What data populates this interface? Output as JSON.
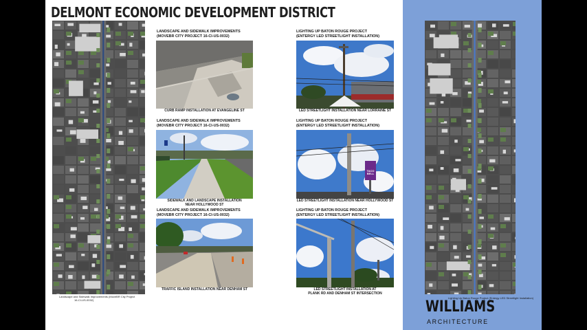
{
  "title": "DELMONT ECONOMIC DEVELOPMENT DISTRICT",
  "left_map_caption": {
    "line1": "Landscape and Sidewalk Improvements (MoveBR City Project",
    "line2": "16-CI-US-0032)"
  },
  "right_map_caption": "Lighting Up Baton Rouge Project (Entergy LED Streetlight Installation)",
  "sections": [
    {
      "heading1": "LANDSCAPE AND SIDEWALK IMPROVEMENTS",
      "heading2": "(MOVEBR CITY PROJECT 16-CI-US-0032)",
      "caption1": "CURB RAMP INSTALLATION AT EVANGELINE ST",
      "caption2": ""
    },
    {
      "heading1": "LIGHTING UP BATON ROUGE PROJECT",
      "heading2": "(ENTERGY LED STREETLIGHT INSTALLATION)",
      "caption1": "LED STREETLIGHT INSTALLATION NEAR LORRAINE ST",
      "caption2": ""
    },
    {
      "heading1": "LANDSCAPE AND SIDEWALK IMPROVEMENTS",
      "heading2": "(MOVEBR CITY PROJECT 16-CI-US-0032)",
      "caption1": "SIDEWALK AND LANDSCAPE INSTALLATION",
      "caption2": "NEAR HOLLYWOOD ST"
    },
    {
      "heading1": "LIGHTING UP BATON ROUGE PROJECT",
      "heading2": "(ENTERGY LED STREETLIGHT INSTALLATION)",
      "caption1": "LED STREETLIGHT INSTALLATION NEAR HOLLYWOOD ST",
      "caption2": ""
    },
    {
      "heading1": "LANDSCAPE AND SIDEWALK IMPROVEMENTS",
      "heading2": "(MOVEBR CITY PROJECT 16-CI-US-0032)",
      "caption1": "TRAFFIC ISLAND INSTALLATION NEAR DENHAM ST",
      "caption2": ""
    },
    {
      "heading1": "LIGHTING UP BATON ROUGE PROJECT",
      "heading2": "(ENTERGY LED STREETLIGHT INSTALLATION)",
      "caption1": "LED STREETLIGHT INSTALLATION AT",
      "caption2": "PLANK RD AND DENHAM ST INTERSECTION"
    }
  ],
  "photos": [
    {
      "icon": "curb-ramp-photo"
    },
    {
      "icon": "streetlight-lorraine-photo"
    },
    {
      "icon": "sidewalk-hollywood-photo"
    },
    {
      "icon": "streetlight-hollywood-photo",
      "sign": "TACO BELL"
    },
    {
      "icon": "traffic-island-photo"
    },
    {
      "icon": "streetlight-plank-photo"
    }
  ],
  "logo": {
    "name": "WILLIAMS",
    "tagline": "ARCHITECTURE"
  },
  "colors": {
    "panel": "#7da0d8",
    "map_bg": "#4a4a4a",
    "route_left": "#2d4b80",
    "route_right": "#4a78c8"
  }
}
